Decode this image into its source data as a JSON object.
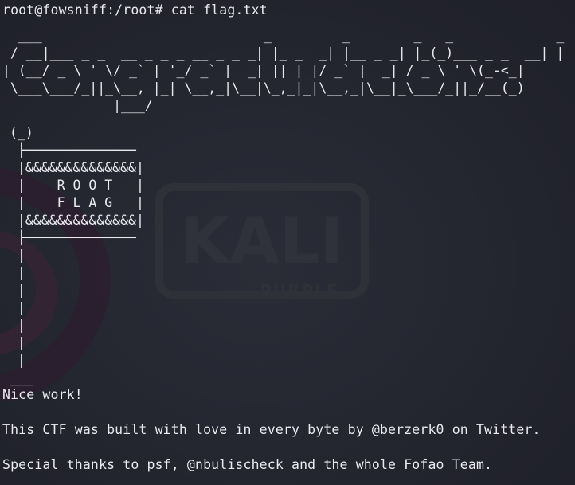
{
  "terminal": {
    "prompt": "root@fowsniff:/root# cat flag.txt",
    "banner": [
      "  ___                            _         _        _   _             _ ",
      " / __|___ _ _  __ _ _ _ __ _ _ _| |_ _  _| |__ _ _| |_(_)___ _ _  __| |",
      "| (__/ _ \\ ' \\/ _` | '_/ _` |  _| || | |/ _` |  _| / _ \\ ' \\(_-<_|",
      " \\___\\___/_||_\\__, |_| \\__,_|\\__|\\_,_|_|\\__,_|\\__|_\\___/_||_/__(_)",
      "              |___/                                                 "
    ],
    "flag_art": [
      "(_)",
      " ├──────────────",
      " |&&&&&&&&&&&&&&|",
      " |    R O O T   |",
      " |    F L A G   |",
      " |&&&&&&&&&&&&&&|",
      " ├──────────────",
      " |",
      " |",
      " |",
      " |",
      " |",
      " |",
      " |",
      "___"
    ],
    "message_1": "Nice work!",
    "message_2": "This CTF was built with love in every byte by @berzerk0 on Twitter.",
    "message_3": "Special thanks to psf, @nbulischeck and the whole Fofao Team."
  },
  "wallpaper": {
    "logo_text": "KALI",
    "logo_subtext": "PURPLE"
  },
  "colors": {
    "background": "#23252f",
    "text": "#e9e9ee",
    "logo": "#34363f"
  }
}
